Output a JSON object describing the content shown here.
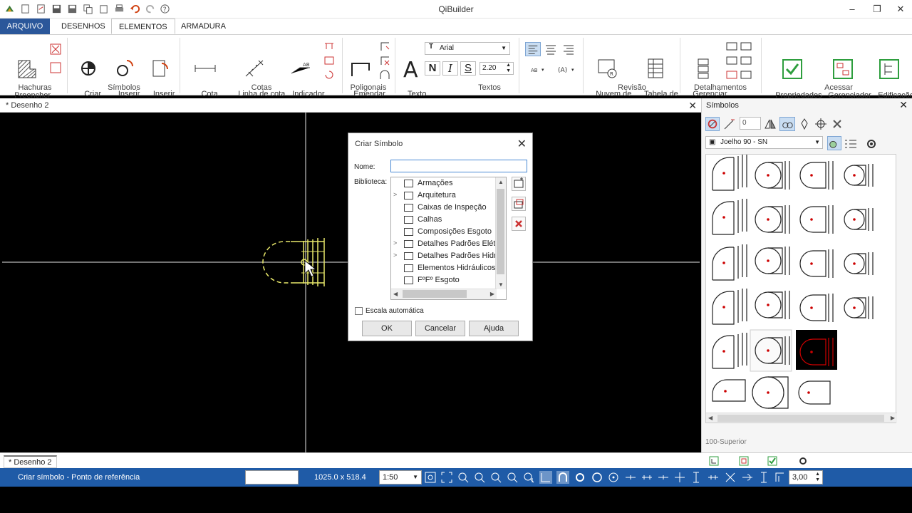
{
  "window": {
    "title": "QiBuilder",
    "controls": {
      "minimize": "–",
      "restore": "❐",
      "close": "✕"
    }
  },
  "ribbon_tabs": [
    {
      "label": "ARQUIVO",
      "state": "file"
    },
    {
      "label": "DESENHOS",
      "state": "normal"
    },
    {
      "label": "ELEMENTOS",
      "state": "active"
    },
    {
      "label": "ARMADURA",
      "state": "normal"
    }
  ],
  "ribbon": {
    "hachuras": {
      "group": "Hachuras",
      "preencher": "Preencher\nárea"
    },
    "simbolos": {
      "group": "Símbolos",
      "criar": "Criar\nsímbolo",
      "inserir_simbolos": "Inserir\nsímbolos",
      "inserir_arquivo": "Inserir\narquivo"
    },
    "cotas": {
      "group": "Cotas",
      "ortogonal": "Cota\northogonal",
      "alinhada": "Linha de cota\nalinhada",
      "indicador": "Indicador"
    },
    "poligonais": {
      "group": "Poligonais",
      "emendar": "Emendar"
    },
    "textos": {
      "group": "Textos",
      "texto": "Texto",
      "font": "Arial",
      "bold": "N",
      "italic": "I",
      "strike": "S",
      "size": "2.20"
    },
    "revisao": {
      "group": "Revisão",
      "nuvem": "Nuvem de\nrevisão",
      "tabela": "Tabela de\nrevisão"
    },
    "detalhamentos": {
      "group": "Detalhamentos",
      "gerenciar": "Gerenciar"
    },
    "acessar": {
      "group": "Acessar",
      "propriedades": "Propriedades",
      "gerenciador": "Gerenciador\nde arquivos",
      "edificacao": "Edificação"
    }
  },
  "document": {
    "tab": "* Desenho 2",
    "bottom_tab": "* Desenho 2"
  },
  "dialog": {
    "title": "Criar Símbolo",
    "nome_label": "Nome:",
    "nome_value": "",
    "biblioteca_label": "Biblioteca:",
    "library_items": [
      {
        "label": "Armações",
        "expandable": false
      },
      {
        "label": "Arquitetura",
        "expandable": true
      },
      {
        "label": "Caixas de Inspeção",
        "expandable": false
      },
      {
        "label": "Calhas",
        "expandable": false
      },
      {
        "label": "Composições Esgoto",
        "expandable": false
      },
      {
        "label": "Detalhes Padrões Elétr",
        "expandable": true
      },
      {
        "label": "Detalhes Padrões Hidr",
        "expandable": true
      },
      {
        "label": "Elementos Hidráulicos",
        "expandable": false
      },
      {
        "label": "FºFº Esgoto",
        "expandable": false
      }
    ],
    "escala_label": "Escala automática",
    "ok": "OK",
    "cancel": "Cancelar",
    "help": "Ajuda"
  },
  "panel": {
    "title": "Símbolos",
    "number_field": "0",
    "symbol_selected": "Joelho 90 - SN",
    "layer": "100-Superior"
  },
  "status": {
    "message": "Criar símbolo - Ponto de referência",
    "coords": "1025.0 x 518.4",
    "scale": "1:50",
    "value": "3,00"
  },
  "colors": {
    "file_tab": "#2b579a",
    "status_bar": "#1f5ba7",
    "drawing_yellow": "#e8e86a",
    "symbol_red": "#cc0000",
    "accept_green": "#2e9e3e"
  }
}
